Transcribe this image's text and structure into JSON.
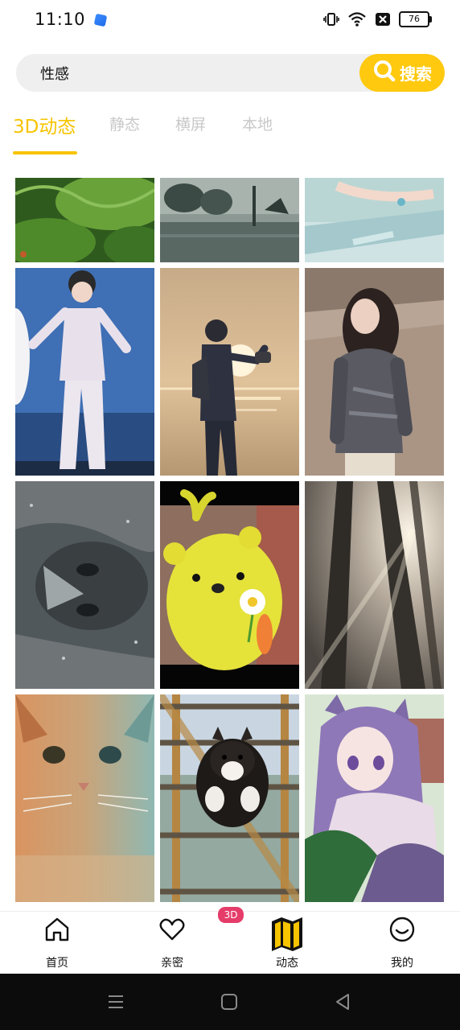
{
  "status_bar": {
    "time": "11:10",
    "battery": "76"
  },
  "search": {
    "value": "性感",
    "button_label": "搜索"
  },
  "tabs": [
    {
      "label": "3D动态",
      "active": true
    },
    {
      "label": "静态",
      "active": false
    },
    {
      "label": "横屏",
      "active": false
    },
    {
      "label": "本地",
      "active": false
    }
  ],
  "grid_items": [
    {
      "name": "forest-wallpaper"
    },
    {
      "name": "lake-trees-wallpaper"
    },
    {
      "name": "bed-scene-wallpaper"
    },
    {
      "name": "stage-performer-wallpaper"
    },
    {
      "name": "sunset-silhouette-wallpaper"
    },
    {
      "name": "beach-girl-wallpaper"
    },
    {
      "name": "rainy-face-wallpaper"
    },
    {
      "name": "yellow-bear-wallpaper"
    },
    {
      "name": "sunlit-forest-wallpaper"
    },
    {
      "name": "cat-wallpaper"
    },
    {
      "name": "husky-puppy-wallpaper"
    },
    {
      "name": "anime-girl-wallpaper"
    }
  ],
  "bottom_nav": [
    {
      "label": "首页",
      "icon": "home-icon"
    },
    {
      "label": "亲密",
      "icon": "heart-icon"
    },
    {
      "label": "动态",
      "icon": "map-icon",
      "active": true
    },
    {
      "label": "我的",
      "icon": "smiley-icon"
    }
  ],
  "badge": "3D",
  "colors": {
    "accent": "#f7c400",
    "search_button": "#ffc90f",
    "badge": "#e53c6a"
  }
}
